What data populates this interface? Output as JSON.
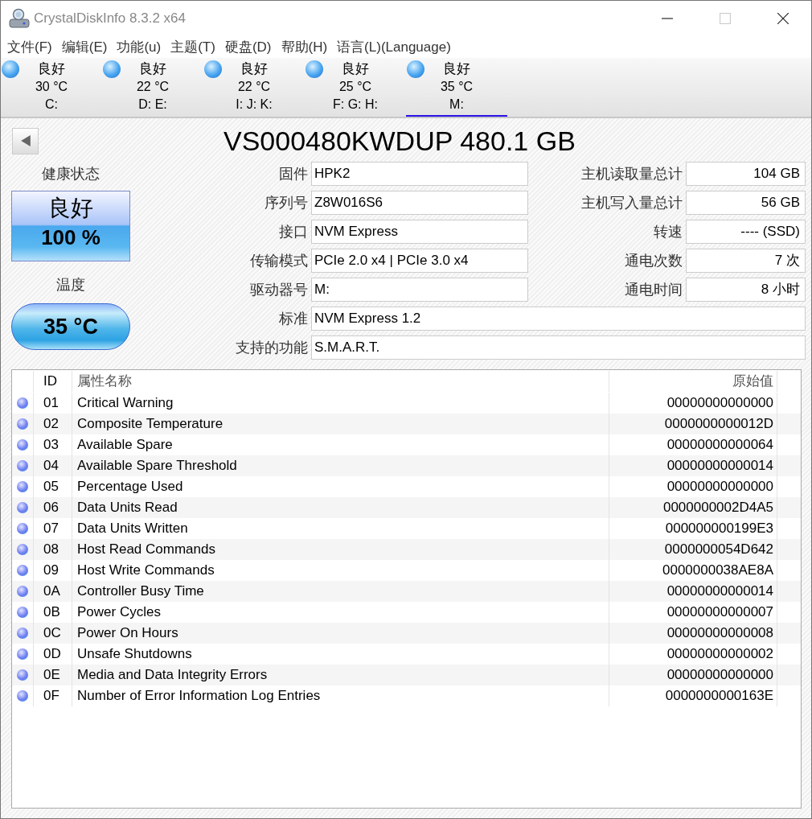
{
  "window": {
    "title": "CrystalDiskInfo 8.3.2 x64"
  },
  "menu": [
    "文件(F)",
    "编辑(E)",
    "功能(u)",
    "主题(T)",
    "硬盘(D)",
    "帮助(H)",
    "语言(L)(Language)"
  ],
  "drives": [
    {
      "status": "良好",
      "temp": "30 °C",
      "letters": "C:",
      "selected": false
    },
    {
      "status": "良好",
      "temp": "22 °C",
      "letters": "D: E:",
      "selected": false
    },
    {
      "status": "良好",
      "temp": "22 °C",
      "letters": "I: J: K:",
      "selected": false
    },
    {
      "status": "良好",
      "temp": "25 °C",
      "letters": "F: G: H:",
      "selected": false
    },
    {
      "status": "良好",
      "temp": "35 °C",
      "letters": "M:",
      "selected": true
    }
  ],
  "disk_title": "VS000480KWDUP 480.1 GB",
  "health": {
    "label": "健康状态",
    "status": "良好",
    "percent": "100 %"
  },
  "temperature": {
    "label": "温度",
    "value": "35 °C"
  },
  "info_left": [
    {
      "label": "固件",
      "value": "HPK2"
    },
    {
      "label": "序列号",
      "value": "Z8W016S6"
    },
    {
      "label": "接口",
      "value": "NVM Express"
    },
    {
      "label": "传输模式",
      "value": "PCIe 2.0 x4 | PCIe 3.0 x4"
    },
    {
      "label": "驱动器号",
      "value": "M:"
    }
  ],
  "info_right": [
    {
      "label": "主机读取量总计",
      "value": "104 GB"
    },
    {
      "label": "主机写入量总计",
      "value": "56 GB"
    },
    {
      "label": "转速",
      "value": "---- (SSD)"
    },
    {
      "label": "通电次数",
      "value": "7 次"
    },
    {
      "label": "通电时间",
      "value": "8 小时"
    }
  ],
  "info_wide": [
    {
      "label": "标准",
      "value": "NVM Express 1.2"
    },
    {
      "label": "支持的功能",
      "value": "S.M.A.R.T."
    }
  ],
  "smart": {
    "columns": [
      "ID",
      "属性名称",
      "原始值"
    ],
    "rows": [
      {
        "id": "01",
        "name": "Critical Warning",
        "raw": "00000000000000"
      },
      {
        "id": "02",
        "name": "Composite Temperature",
        "raw": "0000000000012D"
      },
      {
        "id": "03",
        "name": "Available Spare",
        "raw": "00000000000064"
      },
      {
        "id": "04",
        "name": "Available Spare Threshold",
        "raw": "00000000000014"
      },
      {
        "id": "05",
        "name": "Percentage Used",
        "raw": "00000000000000"
      },
      {
        "id": "06",
        "name": "Data Units Read",
        "raw": "0000000002D4A5"
      },
      {
        "id": "07",
        "name": "Data Units Written",
        "raw": "000000000199E3"
      },
      {
        "id": "08",
        "name": "Host Read Commands",
        "raw": "0000000054D642"
      },
      {
        "id": "09",
        "name": "Host Write Commands",
        "raw": "0000000038AE8A"
      },
      {
        "id": "0A",
        "name": "Controller Busy Time",
        "raw": "00000000000014"
      },
      {
        "id": "0B",
        "name": "Power Cycles",
        "raw": "00000000000007"
      },
      {
        "id": "0C",
        "name": "Power On Hours",
        "raw": "00000000000008"
      },
      {
        "id": "0D",
        "name": "Unsafe Shutdowns",
        "raw": "00000000000002"
      },
      {
        "id": "0E",
        "name": "Media and Data Integrity Errors",
        "raw": "00000000000000"
      },
      {
        "id": "0F",
        "name": "Number of Error Information Log Entries",
        "raw": "0000000000163E"
      }
    ]
  }
}
